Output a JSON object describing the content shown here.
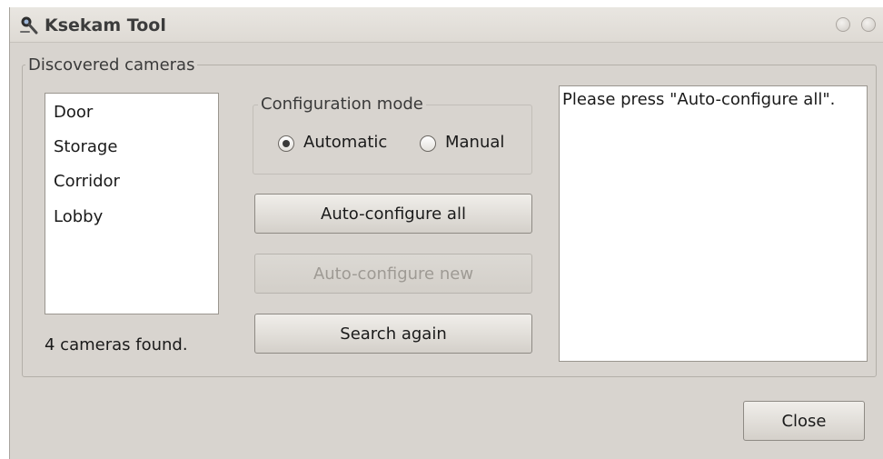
{
  "window": {
    "title": "Ksekam Tool",
    "app_icon": "camera-icon"
  },
  "cameras_group": {
    "title": "Discovered cameras",
    "cameras": [
      "Door",
      "Storage",
      "Corridor",
      "Lobby"
    ],
    "status": "4 cameras found."
  },
  "config_mode": {
    "title": "Configuration mode",
    "options": [
      "Automatic",
      "Manual"
    ],
    "selected": "Automatic"
  },
  "buttons": {
    "auto_configure_all": "Auto-configure all",
    "auto_configure_new": "Auto-configure new",
    "search_again": "Search again",
    "close": "Close"
  },
  "message": "Please press \"Auto-configure all\".",
  "colors": {
    "window_bg": "#d8d4cf",
    "field_bg": "#ffffff",
    "disabled_text": "#9e9a94"
  }
}
